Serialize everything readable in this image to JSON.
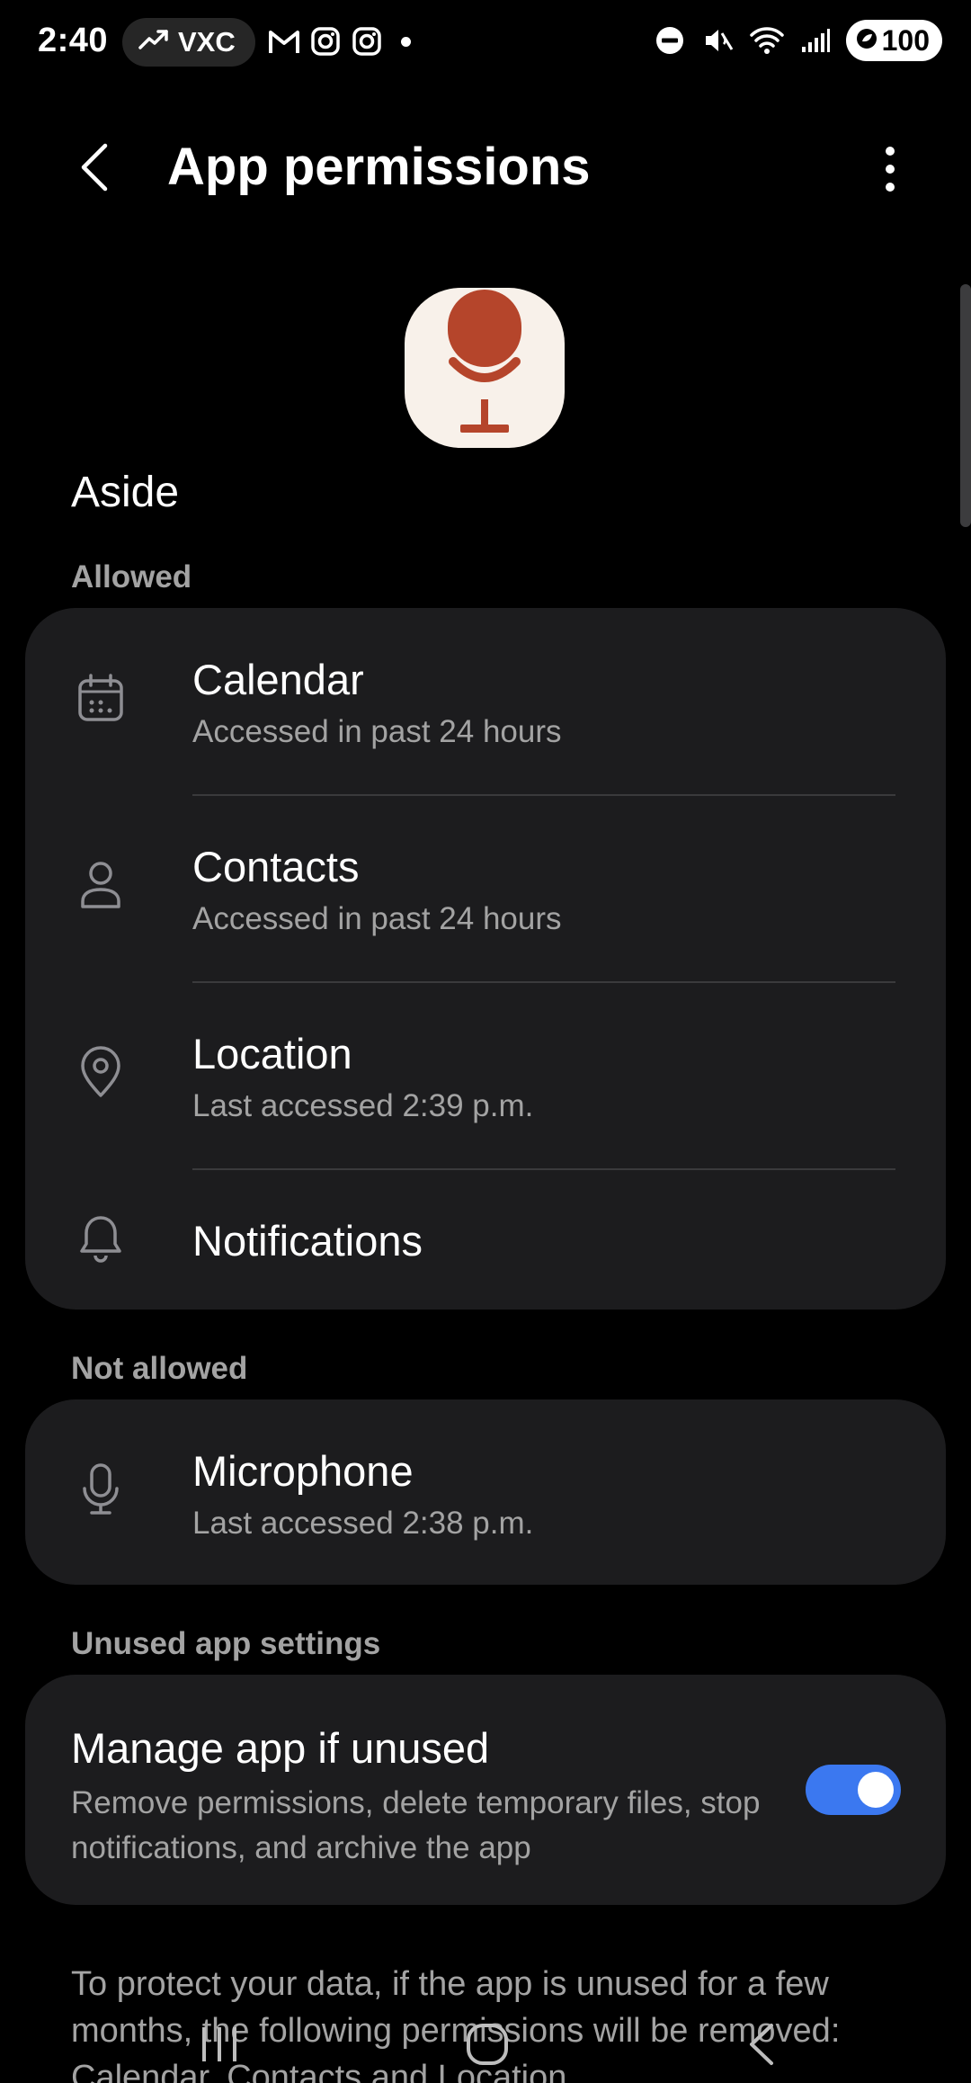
{
  "status_bar": {
    "time": "2:40",
    "trend_label": "VXC",
    "notification_icons": [
      "gmail-icon",
      "instagram-icon",
      "instagram-icon"
    ],
    "battery_level": "100"
  },
  "header": {
    "title": "App permissions"
  },
  "app": {
    "name": "Aside",
    "icon_colors": {
      "background": "#f8f1ea",
      "mic": "#b5452b"
    }
  },
  "sections": {
    "allowed_label": "Allowed",
    "not_allowed_label": "Not allowed",
    "unused_label": "Unused app settings"
  },
  "allowed": [
    {
      "title": "Calendar",
      "subtitle": "Accessed in past 24 hours",
      "icon": "calendar-icon"
    },
    {
      "title": "Contacts",
      "subtitle": "Accessed in past 24 hours",
      "icon": "person-icon"
    },
    {
      "title": "Location",
      "subtitle": "Last accessed 2:39 p.m.",
      "icon": "location-pin-icon"
    },
    {
      "title": "Notifications",
      "icon": "bell-icon"
    }
  ],
  "not_allowed": [
    {
      "title": "Microphone",
      "subtitle": "Last accessed 2:38 p.m.",
      "icon": "microphone-icon"
    }
  ],
  "unused_settings": {
    "title": "Manage app if unused",
    "description": "Remove permissions, delete temporary files, stop notifications, and archive the app",
    "enabled": true,
    "toggle_color": "#3b78f0"
  },
  "footer_note": "To protect your data, if the app is unused for a few months, the following permissions will be removed: Calendar, Contacts and Location"
}
